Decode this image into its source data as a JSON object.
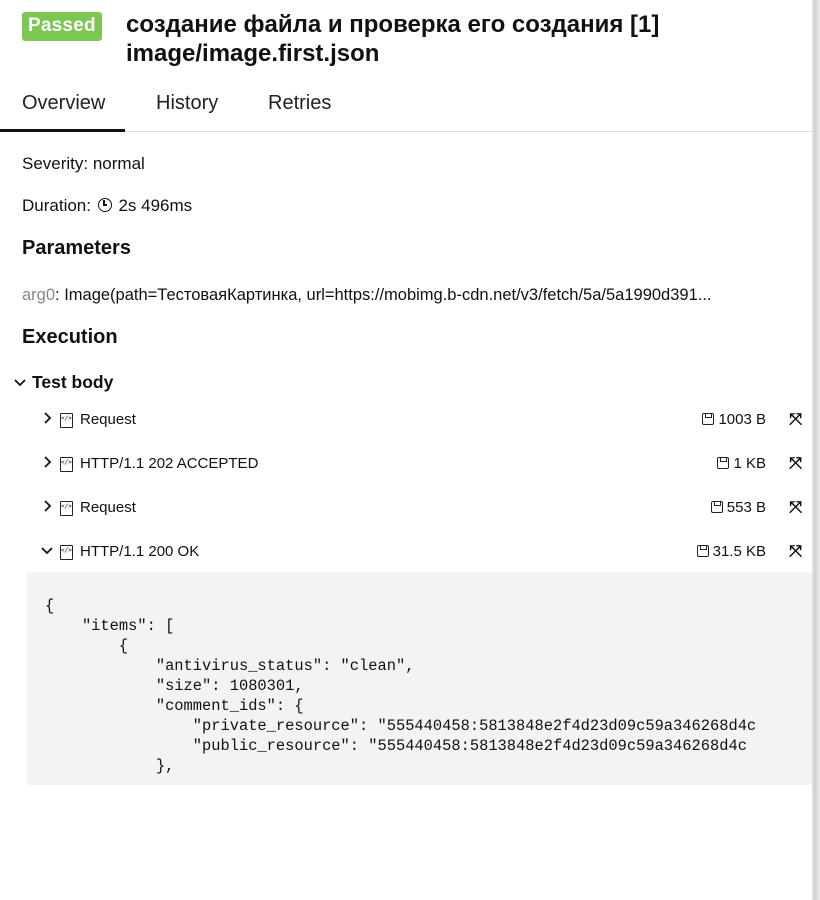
{
  "header": {
    "status": "Passed",
    "title_line1": "создание файла и проверка его создания [1]",
    "title_line2": "image/image.first.json",
    "status_color": "#7cc653"
  },
  "tabs": [
    {
      "label": "Overview",
      "active": true
    },
    {
      "label": "History",
      "active": false
    },
    {
      "label": "Retries",
      "active": false
    }
  ],
  "overview": {
    "severity": "Severity: normal",
    "duration_label": "Duration:",
    "duration_value": "2s 496ms",
    "parameters_title": "Parameters",
    "param_key": "arg0",
    "param_value": ": Image(path=ТестоваяКартинка, url=https://mobimg.b-cdn.net/v3/fetch/5a/5a1990d391...",
    "execution_title": "Execution",
    "test_body_label": "Test body"
  },
  "steps": [
    {
      "name": "Request",
      "size": "1003 B",
      "expanded": false
    },
    {
      "name": "HTTP/1.1 202 ACCEPTED",
      "size": "1 KB",
      "expanded": false
    },
    {
      "name": "Request",
      "size": "553 B",
      "expanded": false
    },
    {
      "name": "HTTP/1.1 200 OK",
      "size": "31.5 KB",
      "expanded": true
    }
  ],
  "icons": {
    "chevron_right": "chevron-right-icon",
    "chevron_down": "chevron-down-icon",
    "clock": "clock-icon",
    "file_code": "file-code-icon",
    "save": "save-icon",
    "expand": "expand-icon"
  },
  "code": "{\n    \"items\": [\n        {\n            \"antivirus_status\": \"clean\",\n            \"size\": 1080301,\n            \"comment_ids\": {\n                \"private_resource\": \"555440458:5813848e2f4d23d09c59a346268d4c\n                \"public_resource\": \"555440458:5813848e2f4d23d09c59a346268d4c\n            },"
}
